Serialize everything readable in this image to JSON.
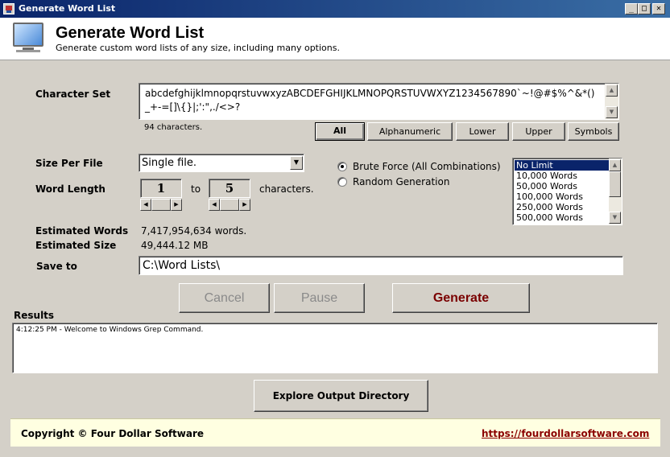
{
  "window": {
    "title": "Generate Word List",
    "min_glyph": "_",
    "max_glyph": "□",
    "close_glyph": "✕"
  },
  "header": {
    "title": "Generate Word List",
    "subtitle": "Generate custom word lists of any size, including many options.",
    "icon": "monitor-icon"
  },
  "charset": {
    "label": "Character Set",
    "value": "abcdefghijklmnopqrstuvwxyzABCDEFGHIJKLMNOPQRSTUVWXYZ1234567890`~!@#$%^&*()_+-=[]\\{}|;':\",./<>?",
    "count_text": "94 characters.",
    "buttons": [
      "All",
      "Alphanumeric",
      "Lower",
      "Upper",
      "Symbols"
    ]
  },
  "size_per_file": {
    "label": "Size Per File",
    "value": "Single file."
  },
  "word_length": {
    "label": "Word Length",
    "min": "1",
    "to_text": "to",
    "max": "5",
    "suffix": "characters."
  },
  "mode": {
    "options": [
      "Brute Force (All Combinations)",
      "Random Generation"
    ],
    "selected": 0
  },
  "limit_list": {
    "items": [
      "No Limit",
      "10,000 Words",
      "50,000 Words",
      "100,000 Words",
      "250,000 Words",
      "500,000 Words"
    ],
    "selected": 0
  },
  "estimates": {
    "words_label": "Estimated Words",
    "words_value": "7,417,954,634 words.",
    "size_label": "Estimated Size",
    "size_value": "49,444.12 MB"
  },
  "save_to": {
    "label": "Save to",
    "value": "C:\\Word Lists\\"
  },
  "actions": {
    "cancel": "Cancel",
    "pause": "Pause",
    "generate": "Generate"
  },
  "results": {
    "label": "Results",
    "log": "4:12:25 PM - Welcome to Windows Grep Command."
  },
  "explore_button": "Explore Output Directory",
  "footer": {
    "copyright": "Copyright © Four Dollar Software",
    "link": "https://fourdollarsoftware.com"
  },
  "colors": {
    "titlebar": "#0a246a",
    "generate_text": "#7a0000",
    "footer_bg": "#ffffe1",
    "link": "#8b0000",
    "selection": "#0a246a"
  }
}
